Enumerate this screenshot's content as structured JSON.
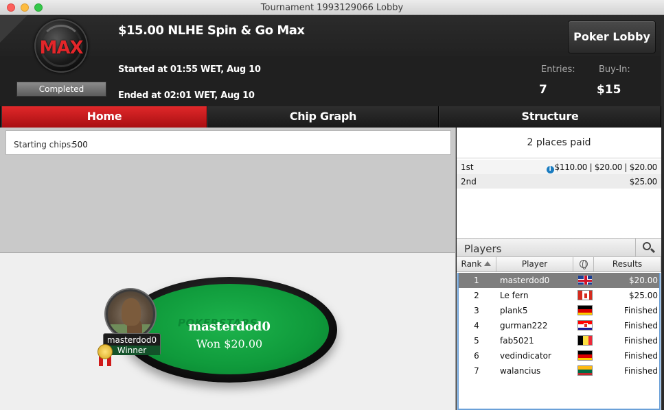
{
  "window": {
    "title": "Tournament 1993129066 Lobby"
  },
  "header": {
    "logo_text": "MAX",
    "status": "Completed",
    "tournament_name": "$15.00 NLHE Spin & Go Max",
    "started": "Started at 01:55 WET, Aug 10",
    "ended": "Ended at 02:01 WET, Aug 10",
    "lobby_button": "Poker Lobby",
    "entries_label": "Entries:",
    "entries_value": "7",
    "buyin_label": "Buy-In:",
    "buyin_value": "$15"
  },
  "tabs": [
    {
      "label": "Home",
      "active": true
    },
    {
      "label": "Chip Graph",
      "active": false
    },
    {
      "label": "Structure",
      "active": false
    }
  ],
  "home": {
    "starting_chips_label": "Starting chips:",
    "starting_chips_value": "500"
  },
  "table": {
    "watermark": "POKERSTARS",
    "winner_name": "masterdod0",
    "won_text": "Won $20.00",
    "seat_name": "masterdod0",
    "seat_status": "Winner"
  },
  "prizes": {
    "header": "2 places paid",
    "rows": [
      {
        "place": "1st",
        "amount": "$110.00 | $20.00 | $20.00",
        "info": true
      },
      {
        "place": "2nd",
        "amount": "$25.00",
        "info": false
      }
    ]
  },
  "players": {
    "title": "Players",
    "columns": {
      "rank": "Rank",
      "player": "Player",
      "results": "Results"
    },
    "rows": [
      {
        "rank": "1",
        "name": "masterdod0",
        "flag": "gb",
        "result": "$20.00",
        "selected": true
      },
      {
        "rank": "2",
        "name": "Le fern",
        "flag": "ca",
        "result": "$25.00",
        "selected": false
      },
      {
        "rank": "3",
        "name": "plank5",
        "flag": "de",
        "result": "Finished",
        "selected": false
      },
      {
        "rank": "4",
        "name": "gurman222",
        "flag": "hr",
        "result": "Finished",
        "selected": false
      },
      {
        "rank": "5",
        "name": "fab5021",
        "flag": "be",
        "result": "Finished",
        "selected": false
      },
      {
        "rank": "6",
        "name": "vedindicator",
        "flag": "de",
        "result": "Finished",
        "selected": false
      },
      {
        "rank": "7",
        "name": "walancius",
        "flag": "lt",
        "result": "Finished",
        "selected": false
      }
    ]
  },
  "colors": {
    "accent_red": "#d01b1f",
    "felt_green": "#0f9a3b",
    "selected_row": "#7e7e7e"
  }
}
